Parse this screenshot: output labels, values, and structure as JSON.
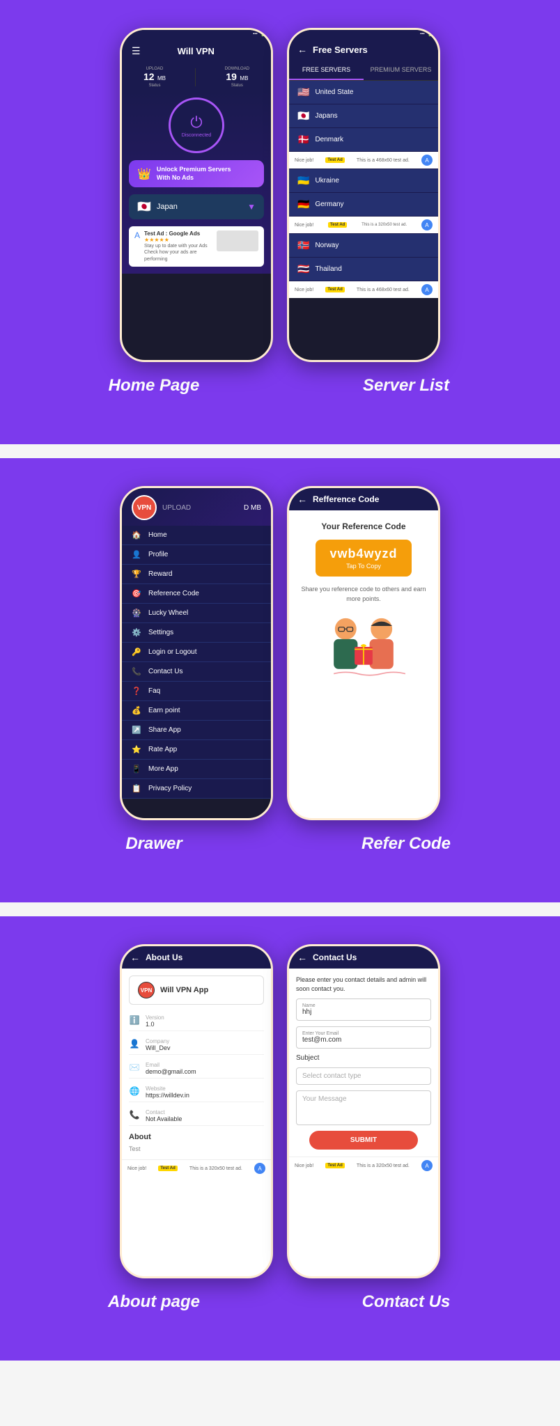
{
  "sections": [
    {
      "id": "home-server",
      "title_left": "Home Page",
      "title_right": "Server List"
    },
    {
      "id": "drawer-refer",
      "title_left": "Drawer",
      "title_right": "Refer Code"
    },
    {
      "id": "about-contact",
      "title_left": "About page",
      "title_right": "Contact Us"
    }
  ],
  "home": {
    "title": "Will VPN",
    "upload_label": "UPLOAD",
    "upload_value": "12",
    "upload_unit": "MB",
    "upload_status": "Status",
    "download_label": "DOWNLOAD",
    "download_value": "19",
    "download_unit": "MB",
    "download_status": "Status",
    "power_status": "Disconnected",
    "premium_text_line1": "Unlock Premium Servers",
    "premium_text_line2": "With No Ads",
    "selected_server": "Japan",
    "ad_title": "Test Ad : Google Ads",
    "ad_desc": "Stay up to date with your Ads Check how your ads are performing"
  },
  "server_list": {
    "header": "Free Servers",
    "tab_free": "FREE SERVERS",
    "tab_premium": "PREMIUM SERVERS",
    "servers": [
      {
        "flag": "🇺🇸",
        "name": "United State"
      },
      {
        "flag": "🇯🇵",
        "name": "Japans"
      },
      {
        "flag": "🇩🇰",
        "name": "Denmark"
      },
      {
        "flag": "🇺🇦",
        "name": "Ukraine"
      },
      {
        "flag": "🇩🇪",
        "name": "Germany"
      },
      {
        "flag": "🇳🇴",
        "name": "Norway"
      },
      {
        "flag": "🇹🇭",
        "name": "Thailand"
      }
    ],
    "ad_text_left": "Nice job!",
    "ad_text_mid": "This is a 468x60 test ad.",
    "ad_badge": "Test Ad"
  },
  "drawer": {
    "logo": "VPN",
    "menu_items": [
      {
        "icon": "🏠",
        "label": "Home"
      },
      {
        "icon": "👤",
        "label": "Profile"
      },
      {
        "icon": "🏆",
        "label": "Reward"
      },
      {
        "icon": "🎯",
        "label": "Reference Code"
      },
      {
        "icon": "🎡",
        "label": "Lucky Wheel"
      },
      {
        "icon": "⚙️",
        "label": "Settings"
      },
      {
        "icon": "🔑",
        "label": "Login or Logout"
      },
      {
        "icon": "📞",
        "label": "Contact Us"
      },
      {
        "icon": "❓",
        "label": "Faq"
      },
      {
        "icon": "💰",
        "label": "Earn point"
      },
      {
        "icon": "↗️",
        "label": "Share App"
      },
      {
        "icon": "⭐",
        "label": "Rate App"
      },
      {
        "icon": "📱",
        "label": "More App"
      },
      {
        "icon": "📋",
        "label": "Privacy Policy"
      }
    ]
  },
  "refer_code": {
    "header": "Refference Code",
    "subtitle": "Your Reference Code",
    "code": "vwb4wyzd",
    "tap_label": "Tap To Copy",
    "desc": "Share you reference code to others and earn more points."
  },
  "about": {
    "header": "About Us",
    "app_name": "Will VPN App",
    "version_label": "Version",
    "version_value": "1.0",
    "company_label": "Company",
    "company_value": "Will_Dev",
    "email_label": "Email",
    "email_value": "demo@gmail.com",
    "website_label": "Website",
    "website_value": "https://willdev.in",
    "contact_label": "Contact",
    "contact_value": "Not Available",
    "about_section": "About",
    "about_text": "Test",
    "ad_left": "Nice job!",
    "ad_badge": "Test Ad",
    "ad_mid": "This is a 320x50 test ad."
  },
  "contact": {
    "header": "Contact Us",
    "desc": "Please enter you contact details and admin will soon contact you.",
    "name_label": "Name",
    "name_value": "hhj",
    "email_label": "Enter Your Email",
    "email_value": "test@m.com",
    "subject_label": "Subject",
    "select_placeholder": "Select contact type",
    "message_placeholder": "Your Message",
    "submit_label": "SUBMIT",
    "ad_left": "Nice job!",
    "ad_badge": "Test Ad",
    "ad_mid": "This is a 320x50 test ad."
  }
}
